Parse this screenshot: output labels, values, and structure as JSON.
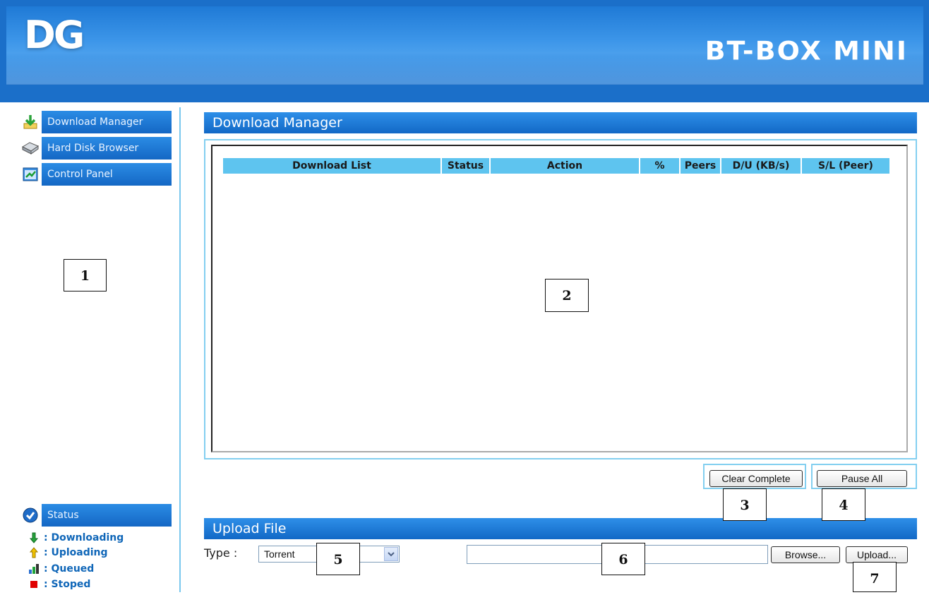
{
  "header": {
    "logo": "DG",
    "product_name": "BT-BOX MINI"
  },
  "sidebar": {
    "items": [
      {
        "label": "Download Manager",
        "icon": "download-arrow-icon"
      },
      {
        "label": "Hard Disk Browser",
        "icon": "hard-disk-icon"
      },
      {
        "label": "Control Panel",
        "icon": "control-panel-icon"
      }
    ],
    "status": {
      "label": "Status",
      "icon": "status-icon"
    },
    "legend": [
      {
        "label": ": Downloading",
        "icon": "green-down-arrow-icon",
        "color": "#1fa33a"
      },
      {
        "label": ": Uploading",
        "icon": "yellow-up-arrow-icon",
        "color": "#e8b400"
      },
      {
        "label": ": Queued",
        "icon": "queued-icon",
        "color": "#2a6fd0"
      },
      {
        "label": ": Stoped",
        "icon": "stop-square-icon",
        "color": "#e00000"
      }
    ]
  },
  "download_manager": {
    "title": "Download Manager",
    "columns": [
      "Download List",
      "Status",
      "Action",
      "%",
      "Peers",
      "D/U (KB/s)",
      "S/L (Peer)"
    ],
    "rows": []
  },
  "buttons": {
    "clear_complete": "Clear Complete",
    "pause_all": "Pause All",
    "browse": "Browse...",
    "upload": "Upload..."
  },
  "upload": {
    "title": "Upload File",
    "type_label": "Type :",
    "type_selected": "Torrent",
    "file_value": ""
  },
  "callouts": [
    "1",
    "2",
    "3",
    "4",
    "5",
    "6",
    "7"
  ],
  "colors": {
    "header_blue": "#1b6fc9",
    "bar_blue": "#1268c6",
    "accent_cyan": "#5ec4ef",
    "outline": "#83cff0"
  }
}
